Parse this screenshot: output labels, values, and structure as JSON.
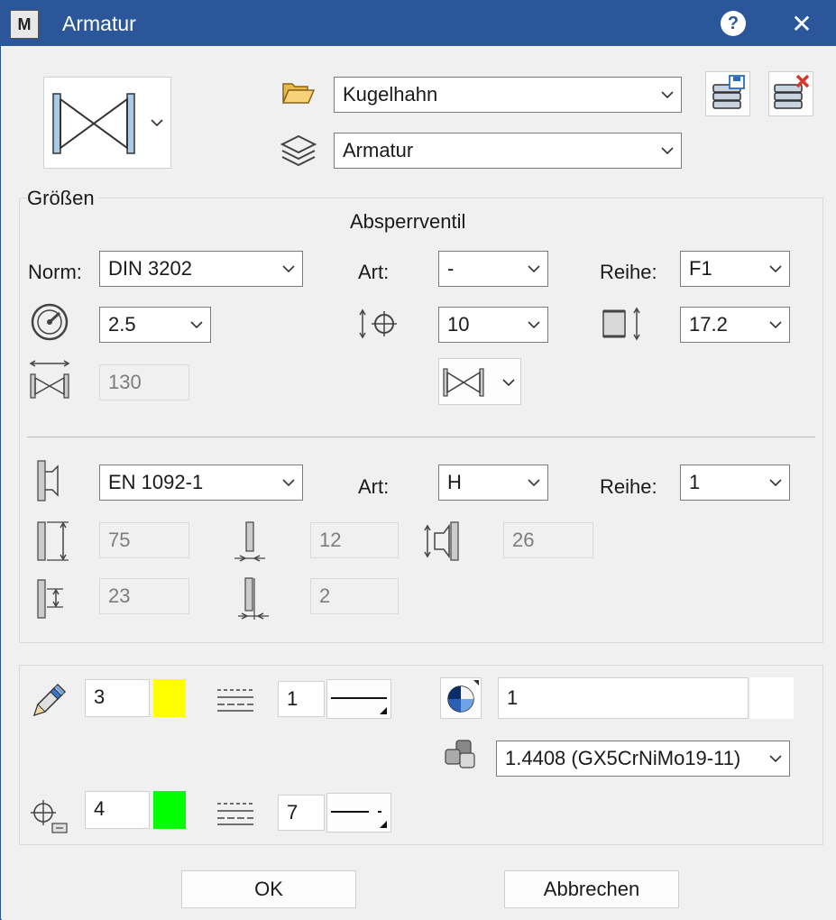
{
  "window": {
    "title": "Armatur",
    "app_icon_letter": "M"
  },
  "top": {
    "catalog_value": "Kugelhahn",
    "layer_value": "Armatur"
  },
  "groesse": {
    "group_label": "Größen",
    "type_heading": "Absperrventil",
    "norm_label": "Norm:",
    "norm_value": "DIN 3202",
    "art_label": "Art:",
    "art_value": "-",
    "reihe_label": "Reihe:",
    "reihe_value": "F1",
    "pressure_value": "2.5",
    "dn_value": "10",
    "pipe_value": "17.2",
    "length_value": "130"
  },
  "flange": {
    "norm_value": "EN 1092-1",
    "art_label": "Art:",
    "art_value": "H",
    "reihe_label": "Reihe:",
    "reihe_value": "1",
    "d1_value": "75",
    "thickness_value": "12",
    "h_value": "26",
    "d2_value": "23",
    "gap_value": "2"
  },
  "style": {
    "pen_value": "3",
    "pen_color": "#ffff00",
    "linetype1_value": "1",
    "material_color_value": "1",
    "material_value": "1.4408 (GX5CrNiMo19-11)",
    "marker_value": "4",
    "marker_color": "#00ff00",
    "linetype2_value": "7"
  },
  "buttons": {
    "ok": "OK",
    "cancel": "Abbrechen"
  }
}
